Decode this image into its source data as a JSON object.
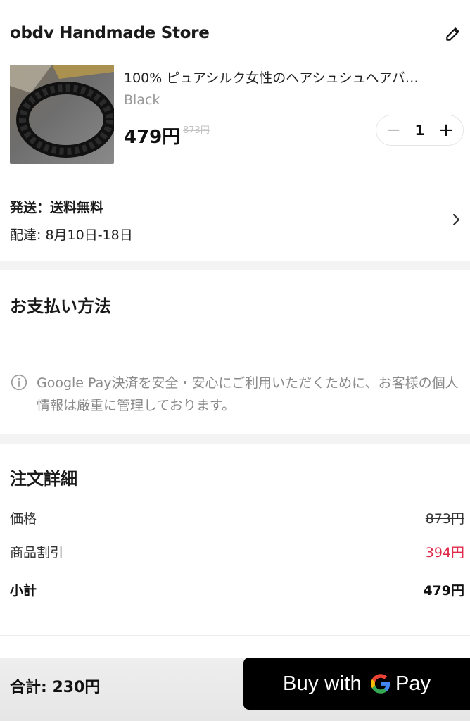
{
  "store": {
    "name": "obdv Handmade Store",
    "edit_icon": "pencil-icon"
  },
  "product": {
    "title": "100% ピュアシルク女性のヘアシュシュヘアバ…",
    "variant": "Black",
    "price": "479円",
    "original_price": "873円",
    "quantity": "1",
    "minus_symbol": "−",
    "plus_symbol": "+"
  },
  "shipping": {
    "label": "発送：送料無料",
    "delivery": "配達: 8月10日-18日",
    "chevron_icon": "chevron-right-icon"
  },
  "payment": {
    "title": "お支払い方法",
    "notice_icon": "info-icon",
    "notice": "Google Pay決済を安全・安心にご利用いただくために、お客様の個人情報は厳重に管理しております。"
  },
  "order": {
    "title": "注文詳細",
    "rows": [
      {
        "label": "価格",
        "value": "873円"
      },
      {
        "label": "商品割引",
        "value": "394円"
      },
      {
        "label": "小計",
        "value": "479円"
      }
    ]
  },
  "footer": {
    "total": "合計:  230円",
    "buy_label": "Buy with",
    "pay_label": "Pay"
  },
  "colors": {
    "discount": "#e0294a",
    "button_bg": "#000000"
  }
}
